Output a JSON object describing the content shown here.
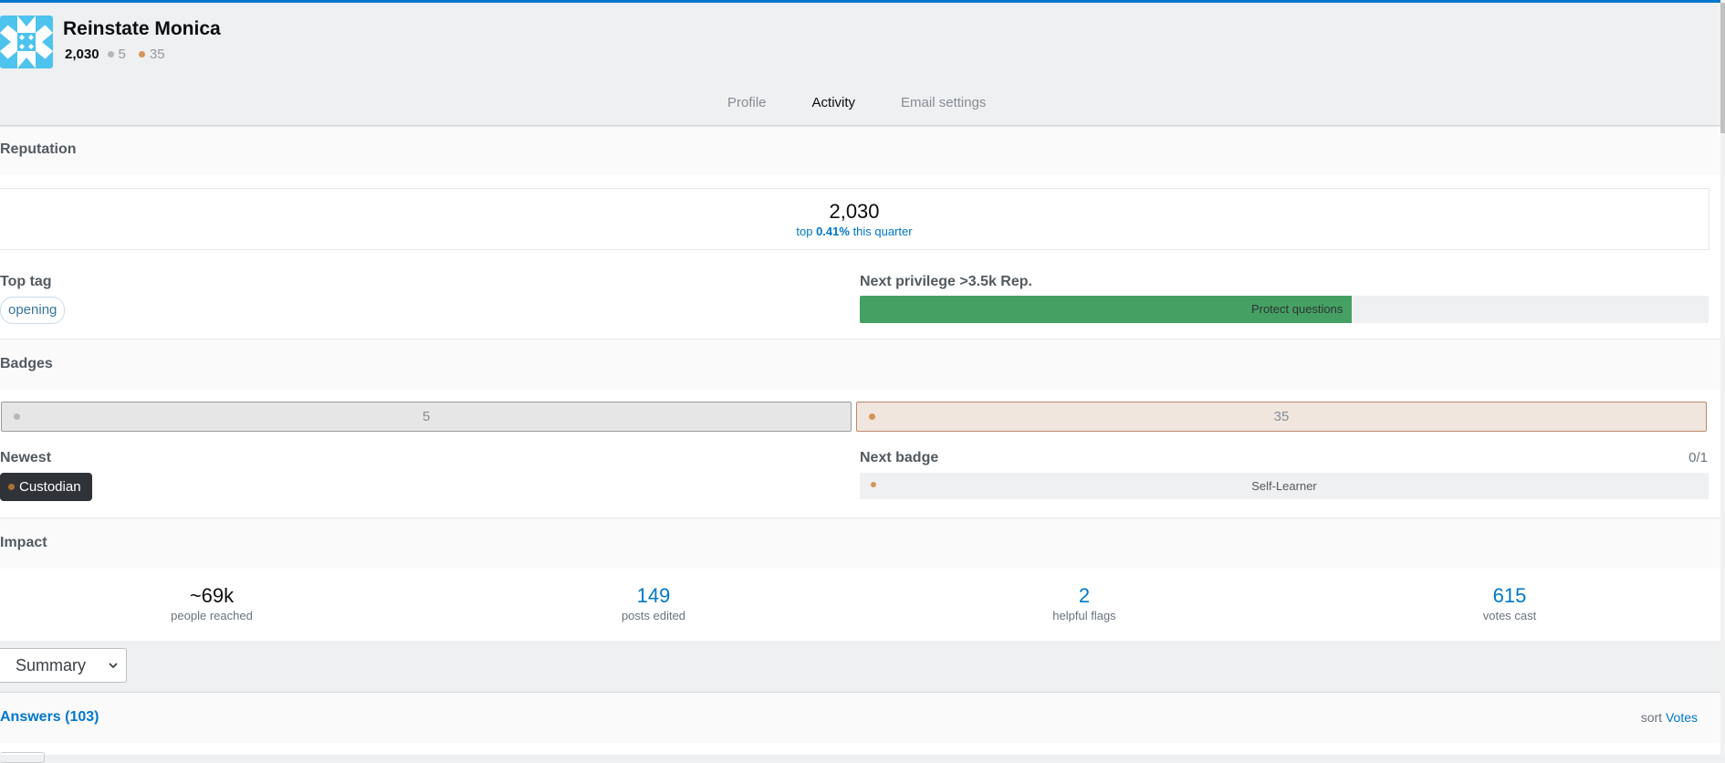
{
  "user": {
    "name": "Reinstate Monica",
    "reputation": "2,030",
    "silver_badges": "5",
    "bronze_badges": "35",
    "avatar_icon": "identicon-avatar"
  },
  "tabs": [
    {
      "label": "Profile",
      "active": false
    },
    {
      "label": "Activity",
      "active": true
    },
    {
      "label": "Email settings",
      "active": false
    }
  ],
  "reputation": {
    "section_title": "Reputation",
    "value": "2,030",
    "rank_prefix": "top ",
    "rank_percent": "0.41%",
    "rank_suffix": " this quarter"
  },
  "top_tag": {
    "label": "Top tag",
    "tag": "opening"
  },
  "next_privilege": {
    "label": "Next privilege >3.5k Rep.",
    "name": "Protect questions",
    "progress_fraction": 0.58
  },
  "badges": {
    "section_title": "Badges",
    "silver_count": "5",
    "bronze_count": "35",
    "newest_label": "Newest",
    "newest_badge": "Custodian",
    "next_badge_label": "Next badge",
    "next_badge_progress": "0/1",
    "next_badge_name": "Self-Learner"
  },
  "impact": {
    "section_title": "Impact",
    "items": [
      {
        "value": "~69k",
        "label": "people reached"
      },
      {
        "value": "149",
        "label": "posts edited"
      },
      {
        "value": "2",
        "label": "helpful flags"
      },
      {
        "value": "615",
        "label": "votes cast"
      }
    ]
  },
  "view_select": {
    "value": "Summary"
  },
  "answers": {
    "title": "Answers (103)",
    "sort_label": "sort",
    "sort_value": "Votes"
  },
  "colors": {
    "accent": "#0077cc",
    "tab_active": "#f48024",
    "progress_fill": "#45a163",
    "bronze": "#cd7f32",
    "silver": "#b4b8bc"
  }
}
